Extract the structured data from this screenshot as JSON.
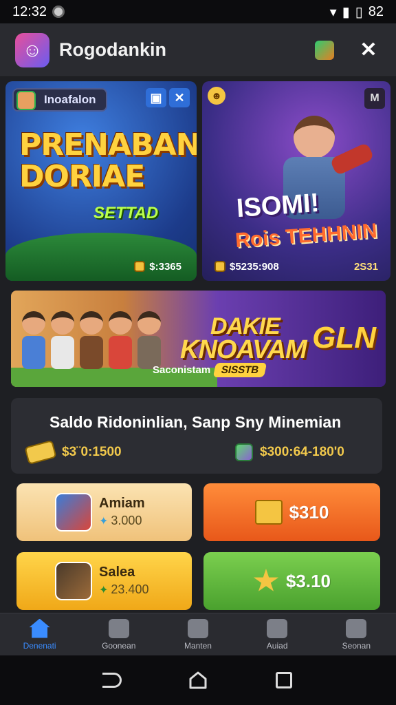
{
  "status_bar": {
    "time": "12:32",
    "battery": "82"
  },
  "app": {
    "title": "Rogodankin"
  },
  "cards": [
    {
      "tag": "Inoafalon",
      "title_line1": "PRENABAN",
      "title_line2": "DORIAE",
      "subtitle": "SETTAD",
      "price": "$:3365"
    },
    {
      "title": "ISOMI!",
      "subtitle": "Rois TEHHNIN",
      "price_left": "$5235:908",
      "price_right": "2S31",
      "corner": "M"
    }
  ],
  "banner": {
    "title_line1": "DAKIE",
    "title_line2": "KNOAVAM",
    "caption": "Saconistam",
    "tag": "SISSTB",
    "coin": "GLN"
  },
  "balance": {
    "title": "Saldo Ridoninlian,  Sanp Sny Minemian",
    "left_value": "$3¨0:1500",
    "right_value": "$300:64-180'0"
  },
  "tiles": [
    {
      "label": "Amiam",
      "value": "3.000"
    },
    {
      "label": "Salea",
      "value": "23.400"
    },
    {
      "value": "$310"
    },
    {
      "value": "$3.10"
    }
  ],
  "nav": [
    {
      "label": "Denenati"
    },
    {
      "label": "Goonean"
    },
    {
      "label": "Manten"
    },
    {
      "label": "Auiad"
    },
    {
      "label": "Seonan"
    }
  ]
}
